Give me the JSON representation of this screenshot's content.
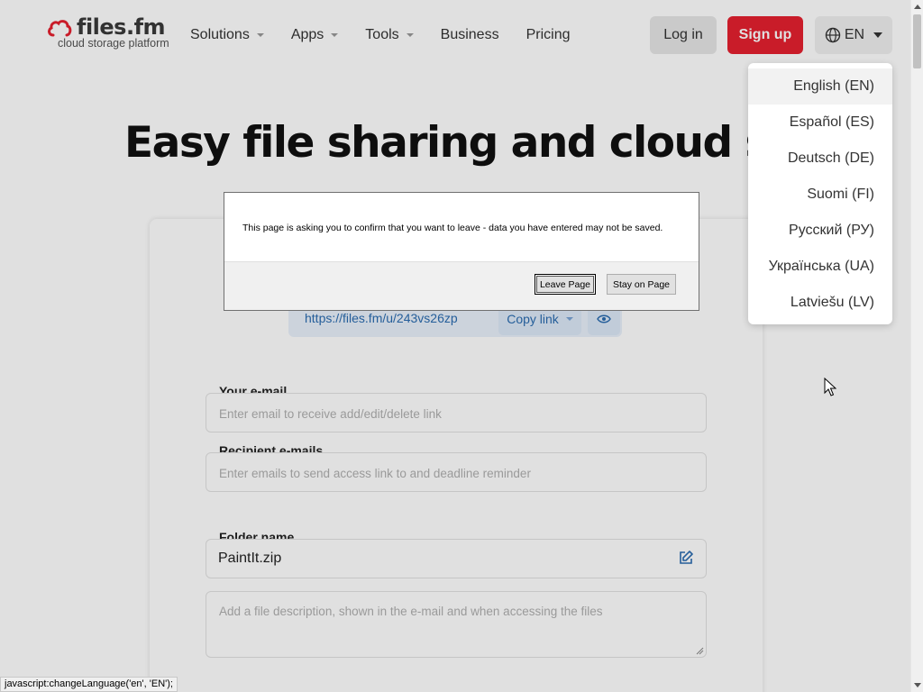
{
  "header": {
    "logo_text": "files.fm",
    "logo_sub": "cloud storage platform",
    "nav": [
      {
        "label": "Solutions"
      },
      {
        "label": "Apps"
      },
      {
        "label": "Tools"
      },
      {
        "label": "Business"
      },
      {
        "label": "Pricing"
      }
    ],
    "login_label": "Log in",
    "signup_label": "Sign up",
    "lang_label": "EN"
  },
  "hero": {
    "title": "Easy file sharing and cloud storage"
  },
  "share": {
    "url": "https://files.fm/u/243vs26zp",
    "copy_label": "Copy link"
  },
  "form": {
    "email_label": "Your e-mail",
    "email_placeholder": "Enter email to receive add/edit/delete link",
    "recipients_label": "Recipient e-mails",
    "recipients_placeholder": "Enter emails to send access link to and deadline reminder",
    "folder_label": "Folder name",
    "folder_value": "PaintIt.zip",
    "description_placeholder": "Add a file description, shown in the e-mail and when accessing the files"
  },
  "language_menu": [
    {
      "label": "English (EN)",
      "active": true
    },
    {
      "label": "Español (ES)"
    },
    {
      "label": "Deutsch (DE)"
    },
    {
      "label": "Suomi (FI)"
    },
    {
      "label": "Русский (РУ)"
    },
    {
      "label": "Українська (UA)"
    },
    {
      "label": "Latviešu (LV)"
    }
  ],
  "dialog": {
    "message": "This page is asking you to confirm that you want to leave - data you have entered may not be saved.",
    "leave_label": "Leave Page",
    "stay_label": "Stay on Page"
  },
  "status_bar": {
    "text": "javascript:changeLanguage('en', 'EN');"
  },
  "colors": {
    "brand_red": "#e5202f",
    "link_blue": "#2b6cb0"
  }
}
